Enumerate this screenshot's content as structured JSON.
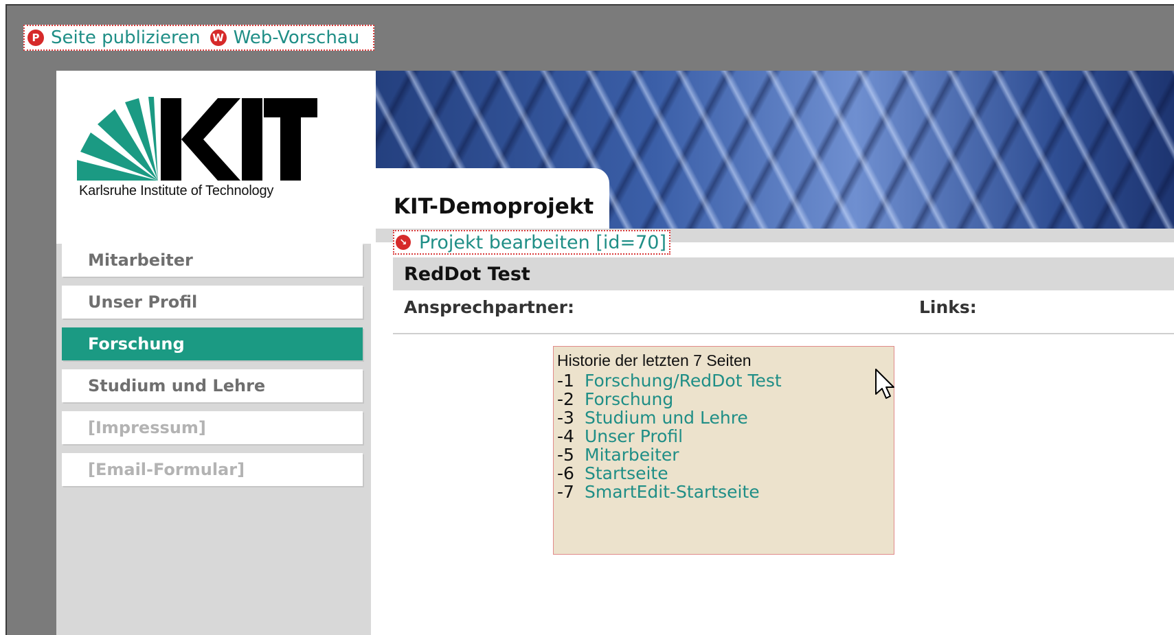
{
  "toolbar": {
    "publish_label": "Seite publizieren",
    "publish_icon": "P",
    "preview_label": "Web-Vorschau",
    "preview_icon": "W"
  },
  "logo": {
    "wordmark": "KIT",
    "tagline": "Karlsruhe Institute of Technology"
  },
  "header": {
    "title": "KIT-Demoprojekt"
  },
  "edit": {
    "label": "Projekt bearbeiten [id=70]"
  },
  "navigation": {
    "items": [
      {
        "label": "Mitarbeiter",
        "state": "normal"
      },
      {
        "label": "Unser Profil",
        "state": "normal"
      },
      {
        "label": "Forschung",
        "state": "active"
      },
      {
        "label": "Studium und Lehre",
        "state": "normal"
      },
      {
        "label": "[Impressum]",
        "state": "disabled"
      },
      {
        "label": "[Email-Formular]",
        "state": "disabled"
      }
    ]
  },
  "content": {
    "section_title": "RedDot Test",
    "contact_label": "Ansprechpartner:",
    "links_label": "Links:"
  },
  "history": {
    "title": "Historie der letzten 7 Seiten",
    "entries": [
      {
        "num": "-1",
        "label": "Forschung/RedDot Test"
      },
      {
        "num": "-2",
        "label": "Forschung"
      },
      {
        "num": "-3",
        "label": "Studium und Lehre"
      },
      {
        "num": "-4",
        "label": "Unser Profil"
      },
      {
        "num": "-5",
        "label": "Mitarbeiter"
      },
      {
        "num": "-6",
        "label": "Startseite"
      },
      {
        "num": "-7",
        "label": "SmartEdit-Startseite"
      }
    ]
  },
  "colors": {
    "accent": "#1b9a83",
    "link": "#1f8e86",
    "reddot": "#d62a2a",
    "history_bg": "#ece2cc"
  }
}
